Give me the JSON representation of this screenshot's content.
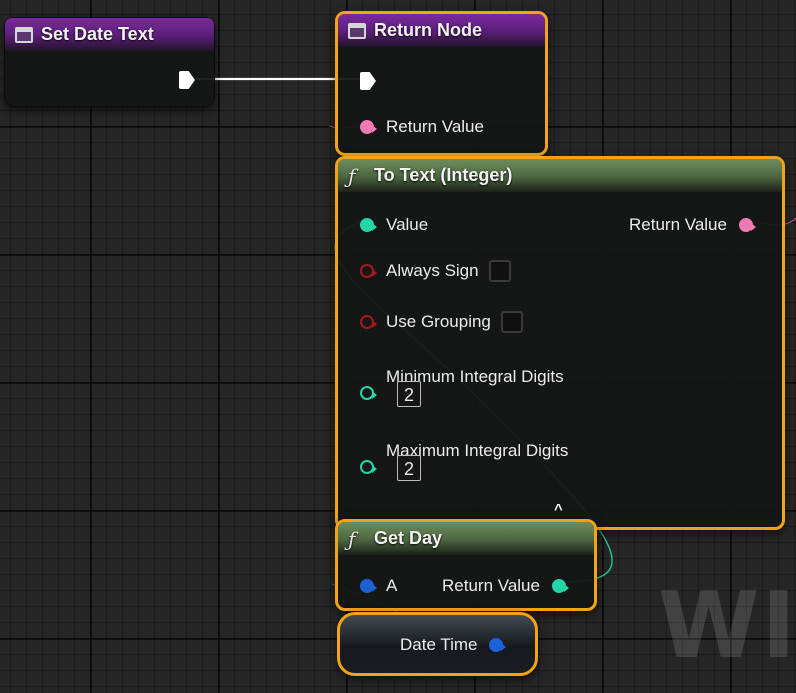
{
  "nodes": {
    "set_date_text": {
      "title": "Set Date Text"
    },
    "return_node": {
      "title": "Return Node",
      "return_value_label": "Return Value"
    },
    "to_text": {
      "title": "To Text (Integer)",
      "value_label": "Value",
      "return_value_label": "Return Value",
      "always_sign_label": "Always Sign",
      "use_grouping_label": "Use Grouping",
      "min_digits_label": "Minimum Integral Digits",
      "min_digits_value": "2",
      "max_digits_label": "Maximum Integral Digits",
      "max_digits_value": "2",
      "collapse_glyph": "^"
    },
    "get_day": {
      "title": "Get Day",
      "a_label": "A",
      "return_value_label": "Return Value"
    },
    "date_time": {
      "label": "Date Time"
    }
  },
  "watermark": "WID",
  "colors": {
    "selection": "#f2a317",
    "exec_wire": "#ffffff",
    "text_pin": "#f07bb4",
    "int_pin": "#22d6a8",
    "struct_pin": "#1a63d6",
    "bool_pin": "#a8181a",
    "event_header": "#6a2390",
    "function_header": "#5c7a4e"
  }
}
